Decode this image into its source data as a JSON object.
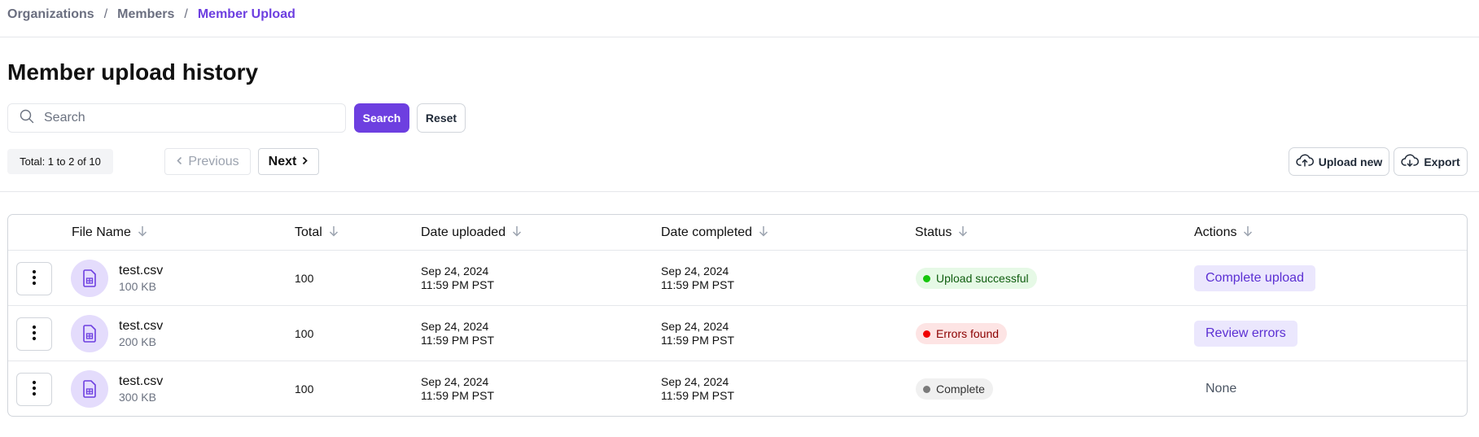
{
  "breadcrumb": {
    "items": [
      "Organizations",
      "Members",
      "Member Upload"
    ],
    "separator": "/"
  },
  "page": {
    "title": "Member upload history"
  },
  "search": {
    "placeholder": "Search",
    "value": "",
    "search_label": "Search",
    "reset_label": "Reset"
  },
  "pagination": {
    "total_text": "Total: 1 to 2 of 10",
    "previous_label": "Previous",
    "next_label": "Next"
  },
  "toolbar": {
    "upload_label": "Upload new",
    "export_label": "Export"
  },
  "table": {
    "columns": [
      "File Name",
      "Total",
      "Date uploaded",
      "Date completed",
      "Status",
      "Actions"
    ],
    "rows": [
      {
        "file_name": "test.csv",
        "file_size": "100 KB",
        "total": "100",
        "uploaded_date": "Sep 24, 2024",
        "uploaded_time": "11:59 PM PST",
        "completed_date": "Sep 24, 2024",
        "completed_time": "11:59 PM PST",
        "status": "Upload successful",
        "action": "Complete upload"
      },
      {
        "file_name": "test.csv",
        "file_size": "200 KB",
        "total": "100",
        "uploaded_date": "Sep 24, 2024",
        "uploaded_time": "11:59 PM PST",
        "completed_date": "Sep 24, 2024",
        "completed_time": "11:59 PM PST",
        "status": "Errors found",
        "action": "Review errors"
      },
      {
        "file_name": "test.csv",
        "file_size": "300 KB",
        "total": "100",
        "uploaded_date": "Sep 24, 2024",
        "uploaded_time": "11:59 PM PST",
        "completed_date": "Sep 24, 2024",
        "completed_time": "11:59 PM PST",
        "status": "Complete",
        "action": "None"
      }
    ]
  },
  "colors": {
    "accent": "#6d3fe0",
    "status_success_bg": "#e6f9e6",
    "status_success_dot": "#16c60c",
    "status_success_text": "#0f5d0f",
    "status_error_bg": "#fde4e4",
    "status_error_dot": "#f00000",
    "status_error_text": "#8b0000",
    "status_complete_bg": "#f0f0f0",
    "status_complete_dot": "#7a7a7a",
    "status_complete_text": "#333333"
  },
  "icons": {
    "search": "search-icon",
    "prev": "chevron-left-icon",
    "next": "chevron-right-icon",
    "upload": "cloud-upload-icon",
    "export": "cloud-download-icon",
    "sort": "arrow-down-icon",
    "row_menu": "kebab-menu-icon",
    "file": "spreadsheet-file-icon"
  }
}
